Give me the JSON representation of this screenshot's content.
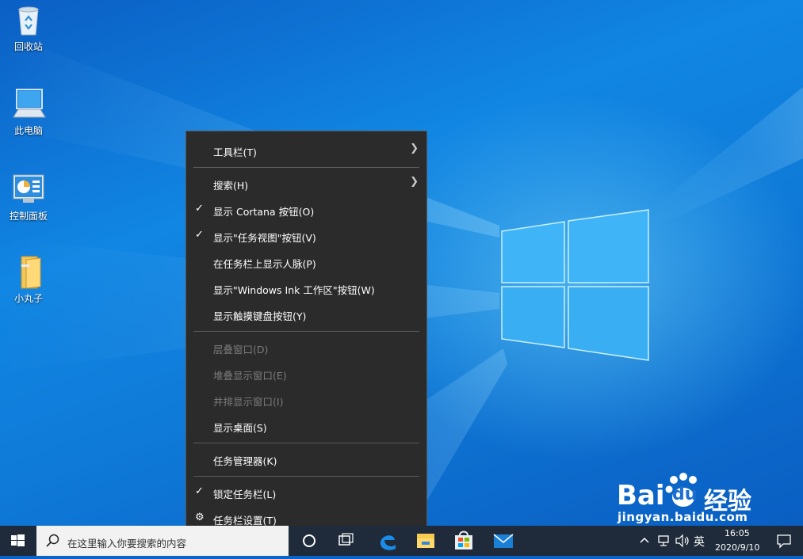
{
  "desktop": {
    "icons": [
      {
        "label": "回收站",
        "icon": "recycle-bin-icon"
      },
      {
        "label": "此电脑",
        "icon": "computer-icon"
      },
      {
        "label": "控制面板",
        "icon": "control-panel-icon"
      },
      {
        "label": "小丸子",
        "icon": "folder-icon"
      }
    ]
  },
  "menu": {
    "items": [
      {
        "label": "工具栏(T)",
        "checked": false,
        "submenu": true,
        "disabled": false
      },
      {
        "label": "搜索(H)",
        "checked": false,
        "submenu": true,
        "disabled": false
      },
      {
        "label": "显示 Cortana 按钮(O)",
        "checked": true,
        "submenu": false,
        "disabled": false
      },
      {
        "label": "显示\"任务视图\"按钮(V)",
        "checked": true,
        "submenu": false,
        "disabled": false
      },
      {
        "label": "在任务栏上显示人脉(P)",
        "checked": false,
        "submenu": false,
        "disabled": false
      },
      {
        "label": "显示\"Windows Ink 工作区\"按钮(W)",
        "checked": false,
        "submenu": false,
        "disabled": false
      },
      {
        "label": "显示触摸键盘按钮(Y)",
        "checked": false,
        "submenu": false,
        "disabled": false
      },
      {
        "label": "层叠窗口(D)",
        "checked": false,
        "submenu": false,
        "disabled": true
      },
      {
        "label": "堆叠显示窗口(E)",
        "checked": false,
        "submenu": false,
        "disabled": true
      },
      {
        "label": "并排显示窗口(I)",
        "checked": false,
        "submenu": false,
        "disabled": true
      },
      {
        "label": "显示桌面(S)",
        "checked": false,
        "submenu": false,
        "disabled": false
      },
      {
        "label": "任务管理器(K)",
        "checked": false,
        "submenu": false,
        "disabled": false
      },
      {
        "label": "锁定任务栏(L)",
        "checked": true,
        "submenu": false,
        "disabled": false
      },
      {
        "label": "任务栏设置(T)",
        "checked": false,
        "submenu": false,
        "disabled": false,
        "icon": "gear-icon"
      }
    ]
  },
  "taskbar": {
    "search_placeholder": "在这里输入你要搜索的内容",
    "apps": [
      "cortana-icon",
      "task-view-icon",
      "edge-icon",
      "file-explorer-icon",
      "store-icon",
      "mail-icon"
    ],
    "tray": {
      "ime": "英",
      "time": "16:05",
      "date": "2020/9/10"
    }
  },
  "watermark": {
    "brand": "Bai",
    "brand2": "du",
    "suffix": "经验",
    "url": "jingyan.baidu.com"
  },
  "colors": {
    "menu_bg": "#2b2b2b",
    "taskbar_bg": "#1f2b3a",
    "arrow_red": "#e8312a"
  }
}
